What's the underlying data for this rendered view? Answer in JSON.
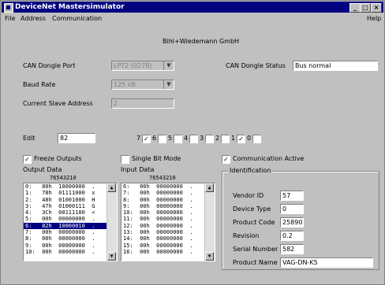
{
  "window": {
    "title": "DeviceNet Mastersimulator"
  },
  "menu": {
    "file": "File",
    "address": "Address",
    "communication": "Communication",
    "help": "Help"
  },
  "company": "Bihl+Wiedemann GmbH",
  "can_dongle_port": {
    "label": "CAN Dongle Port",
    "value": "LPT2 (0278)"
  },
  "can_dongle_status": {
    "label": "CAN Dongle Status",
    "value": "Bus normal"
  },
  "baud_rate": {
    "label": "Baud Rate",
    "value": "125 kB"
  },
  "current_slave": {
    "label": "Current Slave Address",
    "value": "2"
  },
  "edit": {
    "label": "Edit",
    "value": "82"
  },
  "bits": [
    {
      "label": "7",
      "checked": true
    },
    {
      "label": "6",
      "checked": false
    },
    {
      "label": "5",
      "checked": false
    },
    {
      "label": "4",
      "checked": false
    },
    {
      "label": "3",
      "checked": false
    },
    {
      "label": "2",
      "checked": false
    },
    {
      "label": "1",
      "checked": true
    },
    {
      "label": "0",
      "checked": false
    }
  ],
  "freeze_outputs": {
    "label": "Freeze Outputs",
    "checked": true
  },
  "single_bit_mode": {
    "label": "Single Bit Mode",
    "checked": false
  },
  "comm_active": {
    "label": "Communication Active",
    "checked": true
  },
  "output_data": {
    "label": "Output Data",
    "header": "76543210",
    "rows": [
      "0:   80h  10000000  .",
      "1:   78h  01111000  x",
      "2:   48h  01001000  H",
      "3:   47h  01000111  G",
      "4:   3Ch  00111100  <",
      "5:   00h  00000000  .",
      "6:   82h  10000010  .",
      "7:   00h  00000000  .",
      "8:   00h  00000000  .",
      "9:   00h  00000000  .",
      "10:  00h  00000000  ."
    ],
    "selected_index": 6
  },
  "input_data": {
    "label": "Input Data",
    "header": "76543210",
    "rows": [
      "6:   00h  00000000  .",
      "7:   00h  00000000  .",
      "8:   00h  00000000  .",
      "9:   00h  00000000  .",
      "10:  00h  00000000  .",
      "11:  00h  00000000  .",
      "12:  00h  00000000  .",
      "13:  00h  00000000  .",
      "14:  00h  00000000  .",
      "15:  00h  00000000  .",
      "16:  00h  00000000  ."
    ]
  },
  "identification": {
    "title": "Identification",
    "vendor_id": {
      "label": "Vendor ID",
      "value": "57"
    },
    "device_type": {
      "label": "Device Type",
      "value": "0"
    },
    "product_code": {
      "label": "Product Code",
      "value": "25890"
    },
    "revision": {
      "label": "Revision",
      "value": "0.2"
    },
    "serial_number": {
      "label": "Serial Number",
      "value": "582"
    },
    "product_name": {
      "label": "Product Name",
      "value": "VAG-DN-K5"
    }
  }
}
